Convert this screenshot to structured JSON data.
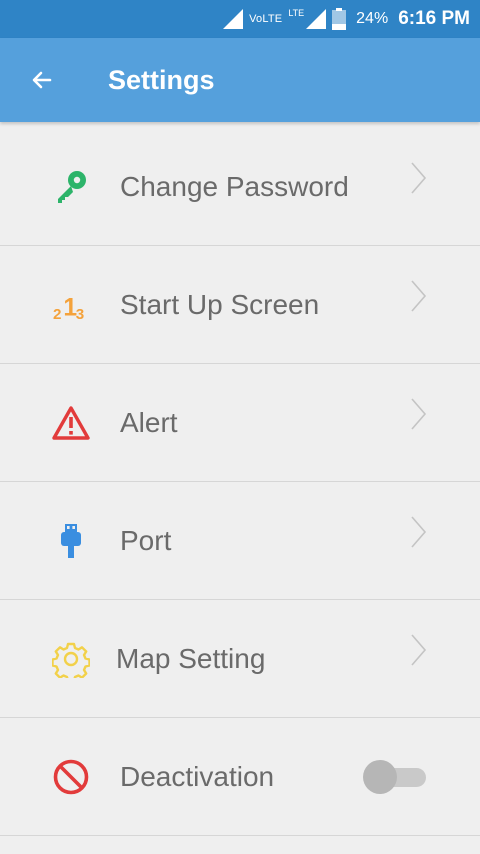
{
  "status_bar": {
    "volte": "VoLTE",
    "lte": "LTE",
    "battery_percent": "24%",
    "time": "6:16 PM"
  },
  "app_bar": {
    "title": "Settings",
    "back_icon": "arrow-left-icon",
    "color": "#55a0dc"
  },
  "settings": {
    "items": [
      {
        "label": "Change Password",
        "icon": "key-icon",
        "icon_color": "#2db46a",
        "control": "chevron"
      },
      {
        "label": "Start Up Screen",
        "icon": "123-icon",
        "icon_color": "#f4a23b",
        "control": "chevron"
      },
      {
        "label": "Alert",
        "icon": "warning-icon",
        "icon_color": "#e23b3b",
        "control": "chevron"
      },
      {
        "label": "Port",
        "icon": "usb-icon",
        "icon_color": "#3a8ee0",
        "control": "chevron"
      },
      {
        "label": "Map Setting",
        "icon": "gear-icon",
        "icon_color": "#f2d14a",
        "control": "chevron"
      },
      {
        "label": "Deactivation",
        "icon": "prohibited-icon",
        "icon_color": "#e23b3b",
        "control": "toggle",
        "toggle_on": false
      }
    ]
  }
}
